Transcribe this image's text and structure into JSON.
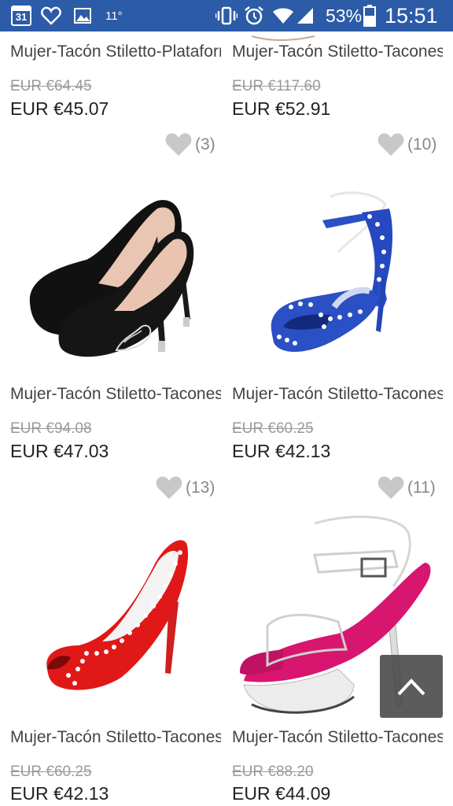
{
  "status_bar": {
    "calendar_day": "31",
    "temperature": "11°",
    "battery_percent": "53%",
    "time": "15:51"
  },
  "products": [
    {
      "title": "Mujer-Tacón Stiletto-Plataforma-Sandalias-",
      "old_price": "EUR €64.45",
      "price": "EUR €45.07"
    },
    {
      "title": "Mujer-Tacón Stiletto-Tacones / Punta",
      "old_price": "EUR €117.60",
      "price": "EUR €52.91"
    },
    {
      "favorites": "(3)",
      "title": "Mujer-Tacón Stiletto-TaconesBoda / Oficina y",
      "old_price": "EUR €94.08",
      "price": "EUR €47.03",
      "image": "black-suede-pump"
    },
    {
      "favorites": "(10)",
      "title": "Mujer-Tacón Stiletto-Tacones / Plataforma-",
      "old_price": "EUR €60.25",
      "price": "EUR €42.13",
      "image": "blue-studded-sandal"
    },
    {
      "favorites": "(13)",
      "title": "Mujer-Tacón Stiletto-Tacones / Punta Abierta /",
      "old_price": "EUR €60.25",
      "price": "EUR €42.13",
      "image": "red-studded-peep-toe"
    },
    {
      "favorites": "(11)",
      "title": "Mujer-Tacón Stiletto-Tacones / Plataforma /",
      "old_price": "EUR €88.20",
      "price": "EUR €44.09",
      "image": "clear-pink-platform"
    }
  ],
  "colors": {
    "status_bar": "#2c5ba7",
    "favorite_heart": "#c8c8c8",
    "back_to_top": "#464646"
  },
  "back_to_top_icon": "chevron-up-icon"
}
